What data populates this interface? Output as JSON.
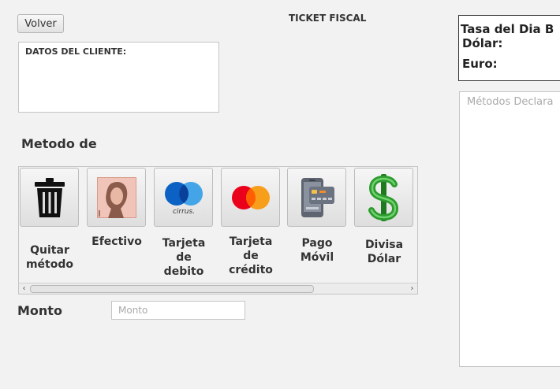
{
  "header": {
    "back_label": "Volver",
    "title": "TICKET FISCAL"
  },
  "client": {
    "heading": "DATOS DEL CLIENTE:"
  },
  "rates": {
    "title": "Tasa del Dia B",
    "dollar_label": "Dólar:",
    "euro_label": "Euro:"
  },
  "declared_methods": {
    "placeholder": "Métodos Declara"
  },
  "payment": {
    "heading": "Metodo de",
    "methods": [
      {
        "line1": "Quitar",
        "line2": "método",
        "line3": "",
        "icon": "trash-icon"
      },
      {
        "line1": "Efectivo",
        "line2": "",
        "line3": "",
        "icon": "cash-portrait-icon"
      },
      {
        "line1": "Tarjeta",
        "line2": "de",
        "line3": "debito",
        "icon": "maestro-cirrus-icon"
      },
      {
        "line1": "Tarjeta",
        "line2": "de",
        "line3": "crédito",
        "icon": "mastercard-icon"
      },
      {
        "line1": "Pago",
        "line2": "Móvil",
        "line3": "",
        "icon": "mobile-payment-icon"
      },
      {
        "line1": "Divisa",
        "line2": "Dólar",
        "line3": "",
        "icon": "dollar-sign-icon"
      }
    ],
    "cirrus_text": "cirrus."
  },
  "amount": {
    "label": "Monto",
    "placeholder": "Monto",
    "value": ""
  },
  "colors": {
    "background": "#f2f2f2",
    "dollar_green": "#2e9b2e",
    "maestro_blue": "#0b62c4",
    "mastercard_red": "#eb001b",
    "mastercard_orange": "#f79e1b"
  }
}
